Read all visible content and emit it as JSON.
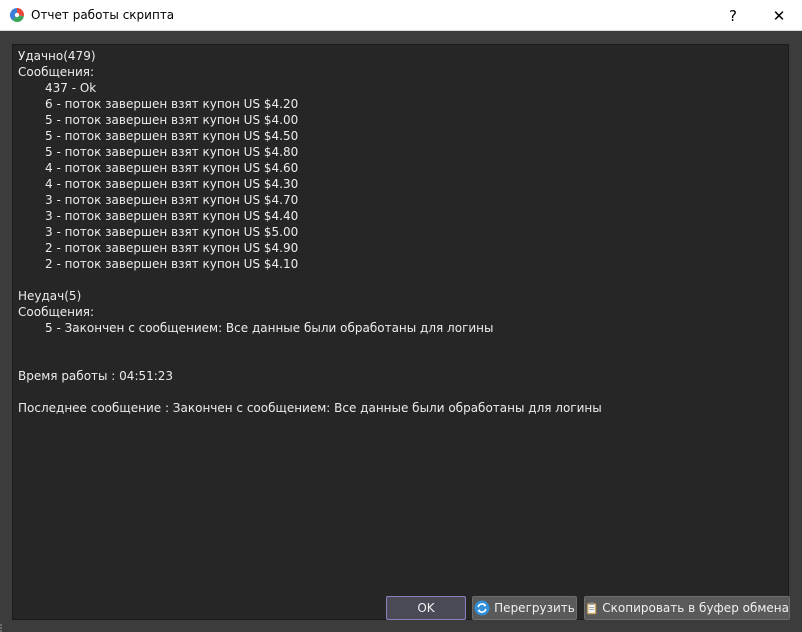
{
  "window": {
    "title": "Отчет работы скрипта",
    "help_label": "?",
    "close_label": "✕"
  },
  "report": {
    "success_header": "Удачно(479)",
    "success_messages_label": "Сообщения:",
    "success_messages": [
      "437 - Ok",
      "6 - поток завершен взят купон US $4.20",
      "5 - поток завершен взят купон US $4.00",
      "5 - поток завершен взят купон US $4.50",
      "5 - поток завершен взят купон US $4.80",
      "4 - поток завершен взят купон US $4.60",
      "4 - поток завершен взят купон US $4.30",
      "3 - поток завершен взят купон US $4.70",
      "3 - поток завершен взят купон US $4.40",
      "3 - поток завершен взят купон US $5.00",
      "2 - поток завершен взят купон US $4.90",
      "2 - поток завершен взят купон US $4.10"
    ],
    "fail_header": "Неудач(5)",
    "fail_messages_label": "Сообщения:",
    "fail_messages": [
      "5 - Закончен с сообщением: Все данные были обработаны для логины"
    ],
    "runtime": "Время работы : 04:51:23",
    "last_message": "Последнее сообщение : Закончен с сообщением: Все данные были обработаны для логины"
  },
  "buttons": {
    "ok_label": "OK",
    "reload_label": "Перегрузить",
    "copy_label": "Скопировать в буфер обмена"
  },
  "icons": {
    "app": "pie-chart-icon",
    "reload": "refresh-icon",
    "copy": "clipboard-icon"
  },
  "colors": {
    "background": "#3c3c3c",
    "report_bg": "#262626",
    "text": "#ececec",
    "ok_border": "#8f7fbf"
  }
}
